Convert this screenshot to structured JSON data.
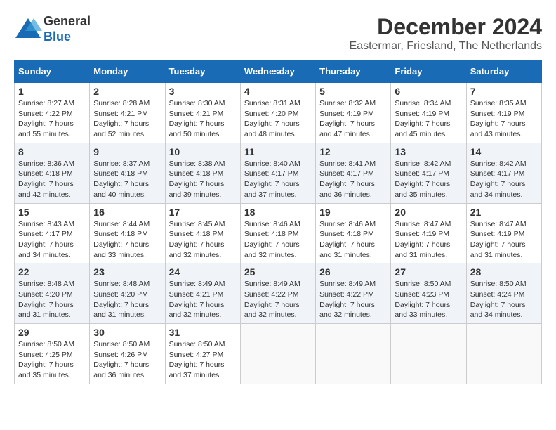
{
  "logo": {
    "line1": "General",
    "line2": "Blue"
  },
  "title": "December 2024",
  "location": "Eastermar, Friesland, The Netherlands",
  "weekdays": [
    "Sunday",
    "Monday",
    "Tuesday",
    "Wednesday",
    "Thursday",
    "Friday",
    "Saturday"
  ],
  "weeks": [
    [
      {
        "day": "1",
        "sunrise": "8:27 AM",
        "sunset": "4:22 PM",
        "daylight": "7 hours and 55 minutes."
      },
      {
        "day": "2",
        "sunrise": "8:28 AM",
        "sunset": "4:21 PM",
        "daylight": "7 hours and 52 minutes."
      },
      {
        "day": "3",
        "sunrise": "8:30 AM",
        "sunset": "4:21 PM",
        "daylight": "7 hours and 50 minutes."
      },
      {
        "day": "4",
        "sunrise": "8:31 AM",
        "sunset": "4:20 PM",
        "daylight": "7 hours and 48 minutes."
      },
      {
        "day": "5",
        "sunrise": "8:32 AM",
        "sunset": "4:19 PM",
        "daylight": "7 hours and 47 minutes."
      },
      {
        "day": "6",
        "sunrise": "8:34 AM",
        "sunset": "4:19 PM",
        "daylight": "7 hours and 45 minutes."
      },
      {
        "day": "7",
        "sunrise": "8:35 AM",
        "sunset": "4:19 PM",
        "daylight": "7 hours and 43 minutes."
      }
    ],
    [
      {
        "day": "8",
        "sunrise": "8:36 AM",
        "sunset": "4:18 PM",
        "daylight": "7 hours and 42 minutes."
      },
      {
        "day": "9",
        "sunrise": "8:37 AM",
        "sunset": "4:18 PM",
        "daylight": "7 hours and 40 minutes."
      },
      {
        "day": "10",
        "sunrise": "8:38 AM",
        "sunset": "4:18 PM",
        "daylight": "7 hours and 39 minutes."
      },
      {
        "day": "11",
        "sunrise": "8:40 AM",
        "sunset": "4:17 PM",
        "daylight": "7 hours and 37 minutes."
      },
      {
        "day": "12",
        "sunrise": "8:41 AM",
        "sunset": "4:17 PM",
        "daylight": "7 hours and 36 minutes."
      },
      {
        "day": "13",
        "sunrise": "8:42 AM",
        "sunset": "4:17 PM",
        "daylight": "7 hours and 35 minutes."
      },
      {
        "day": "14",
        "sunrise": "8:42 AM",
        "sunset": "4:17 PM",
        "daylight": "7 hours and 34 minutes."
      }
    ],
    [
      {
        "day": "15",
        "sunrise": "8:43 AM",
        "sunset": "4:17 PM",
        "daylight": "7 hours and 34 minutes."
      },
      {
        "day": "16",
        "sunrise": "8:44 AM",
        "sunset": "4:18 PM",
        "daylight": "7 hours and 33 minutes."
      },
      {
        "day": "17",
        "sunrise": "8:45 AM",
        "sunset": "4:18 PM",
        "daylight": "7 hours and 32 minutes."
      },
      {
        "day": "18",
        "sunrise": "8:46 AM",
        "sunset": "4:18 PM",
        "daylight": "7 hours and 32 minutes."
      },
      {
        "day": "19",
        "sunrise": "8:46 AM",
        "sunset": "4:18 PM",
        "daylight": "7 hours and 31 minutes."
      },
      {
        "day": "20",
        "sunrise": "8:47 AM",
        "sunset": "4:19 PM",
        "daylight": "7 hours and 31 minutes."
      },
      {
        "day": "21",
        "sunrise": "8:47 AM",
        "sunset": "4:19 PM",
        "daylight": "7 hours and 31 minutes."
      }
    ],
    [
      {
        "day": "22",
        "sunrise": "8:48 AM",
        "sunset": "4:20 PM",
        "daylight": "7 hours and 31 minutes."
      },
      {
        "day": "23",
        "sunrise": "8:48 AM",
        "sunset": "4:20 PM",
        "daylight": "7 hours and 31 minutes."
      },
      {
        "day": "24",
        "sunrise": "8:49 AM",
        "sunset": "4:21 PM",
        "daylight": "7 hours and 32 minutes."
      },
      {
        "day": "25",
        "sunrise": "8:49 AM",
        "sunset": "4:22 PM",
        "daylight": "7 hours and 32 minutes."
      },
      {
        "day": "26",
        "sunrise": "8:49 AM",
        "sunset": "4:22 PM",
        "daylight": "7 hours and 32 minutes."
      },
      {
        "day": "27",
        "sunrise": "8:50 AM",
        "sunset": "4:23 PM",
        "daylight": "7 hours and 33 minutes."
      },
      {
        "day": "28",
        "sunrise": "8:50 AM",
        "sunset": "4:24 PM",
        "daylight": "7 hours and 34 minutes."
      }
    ],
    [
      {
        "day": "29",
        "sunrise": "8:50 AM",
        "sunset": "4:25 PM",
        "daylight": "7 hours and 35 minutes."
      },
      {
        "day": "30",
        "sunrise": "8:50 AM",
        "sunset": "4:26 PM",
        "daylight": "7 hours and 36 minutes."
      },
      {
        "day": "31",
        "sunrise": "8:50 AM",
        "sunset": "4:27 PM",
        "daylight": "7 hours and 37 minutes."
      },
      null,
      null,
      null,
      null
    ]
  ],
  "colors": {
    "header_bg": "#1a6bb5",
    "even_row_bg": "#f0f4f8",
    "logo_blue": "#1a6bb5"
  }
}
